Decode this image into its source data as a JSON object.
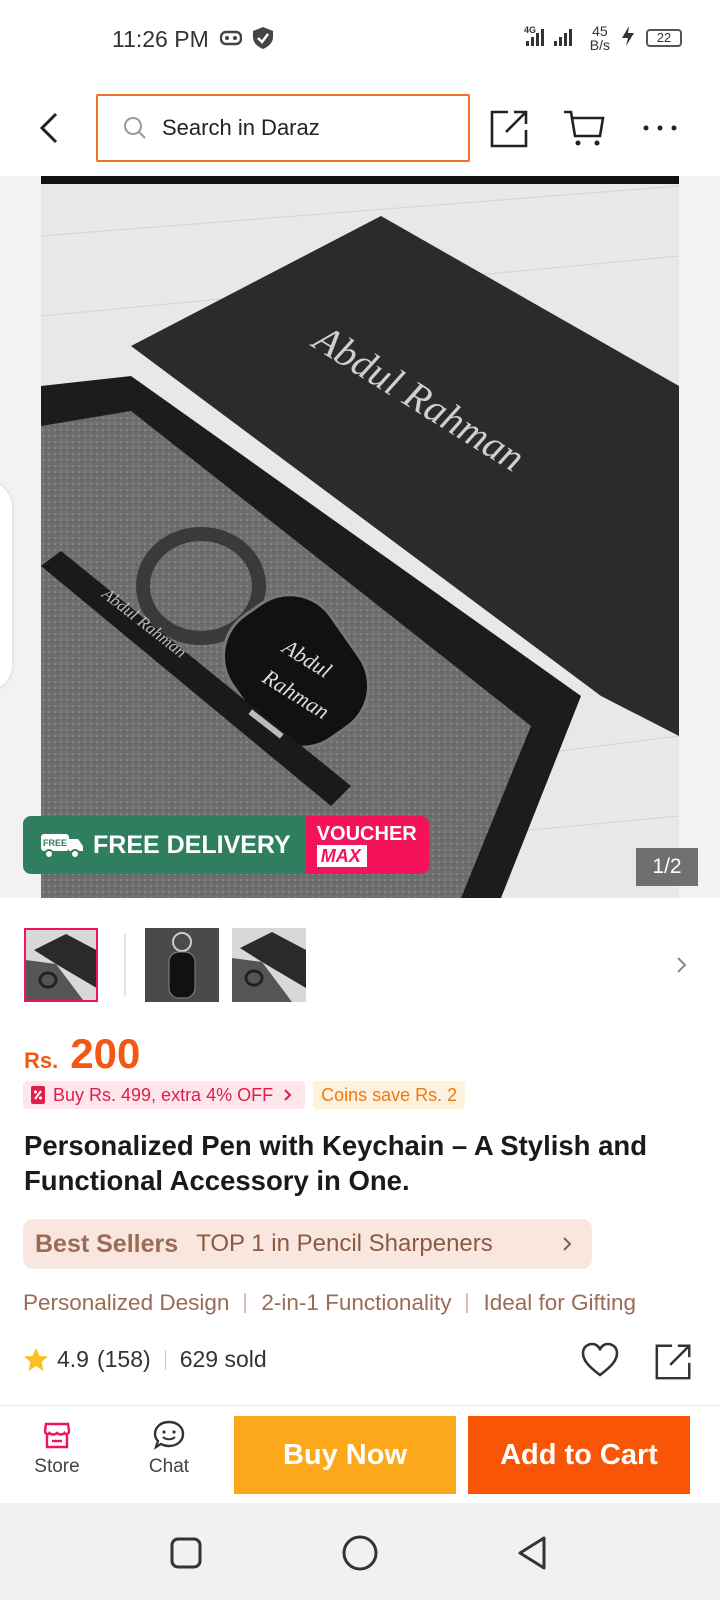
{
  "status_bar": {
    "time": "11:26 PM",
    "network": "4G",
    "speed_value": "45",
    "speed_unit": "B/s",
    "battery": "22"
  },
  "top_nav": {
    "search_placeholder": "Search in Daraz",
    "accent_color": "#f36f21"
  },
  "gallery": {
    "photo_engraving": "Abdul Rahman",
    "badge_free_delivery": "FREE DELIVERY",
    "badge_free_small": "FREE",
    "badge_voucher_top": "VOUCHER",
    "badge_voucher_bottom": "MAX",
    "page_indicator": "1/2"
  },
  "price": {
    "currency": "Rs.",
    "value": "200",
    "color": "#f25714"
  },
  "promos": {
    "buy_more": "Buy Rs. 499, extra 4% OFF",
    "coins": "Coins save Rs. 2"
  },
  "product": {
    "title": "Personalized Pen with Keychain – A Stylish and Functional Accessory in One."
  },
  "best_sellers": {
    "label": "Best Sellers",
    "text": "TOP 1 in Pencil Sharpeners"
  },
  "features": [
    "Personalized Design",
    "2-in-1 Functionality",
    "Ideal for Gifting"
  ],
  "rating": {
    "score": "4.9",
    "count": "(158)",
    "sold": "629 sold"
  },
  "action_bar": {
    "store_label": "Store",
    "chat_label": "Chat",
    "buy_now_label": "Buy Now",
    "add_to_cart_label": "Add to Cart",
    "buy_now_color": "#fba81a",
    "add_to_cart_color": "#f85606"
  }
}
